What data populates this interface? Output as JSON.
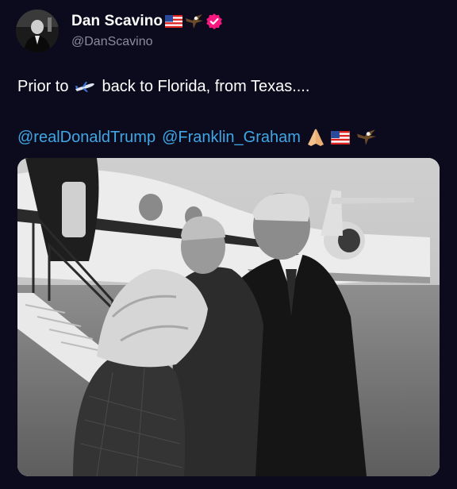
{
  "author": {
    "display_name": "Dan Scavino",
    "handle": "@DanScavino",
    "badges": [
      "us-flag-icon",
      "eagle-icon",
      "verified-badge-icon"
    ]
  },
  "tweet": {
    "text_before": "Prior to",
    "inline_emoji": "airplane-icon",
    "text_after": "back to Florida, from Texas....",
    "mentions": [
      "@realDonaldTrump",
      "@Franklin_Graham"
    ],
    "trailing_emoji": [
      "praying-hands-icon",
      "us-flag-icon",
      "eagle-icon"
    ]
  },
  "colors": {
    "background": "#0c0b1d",
    "mention": "#3fa7e6",
    "handle": "#8b8b9e",
    "verified": "#f91880"
  }
}
